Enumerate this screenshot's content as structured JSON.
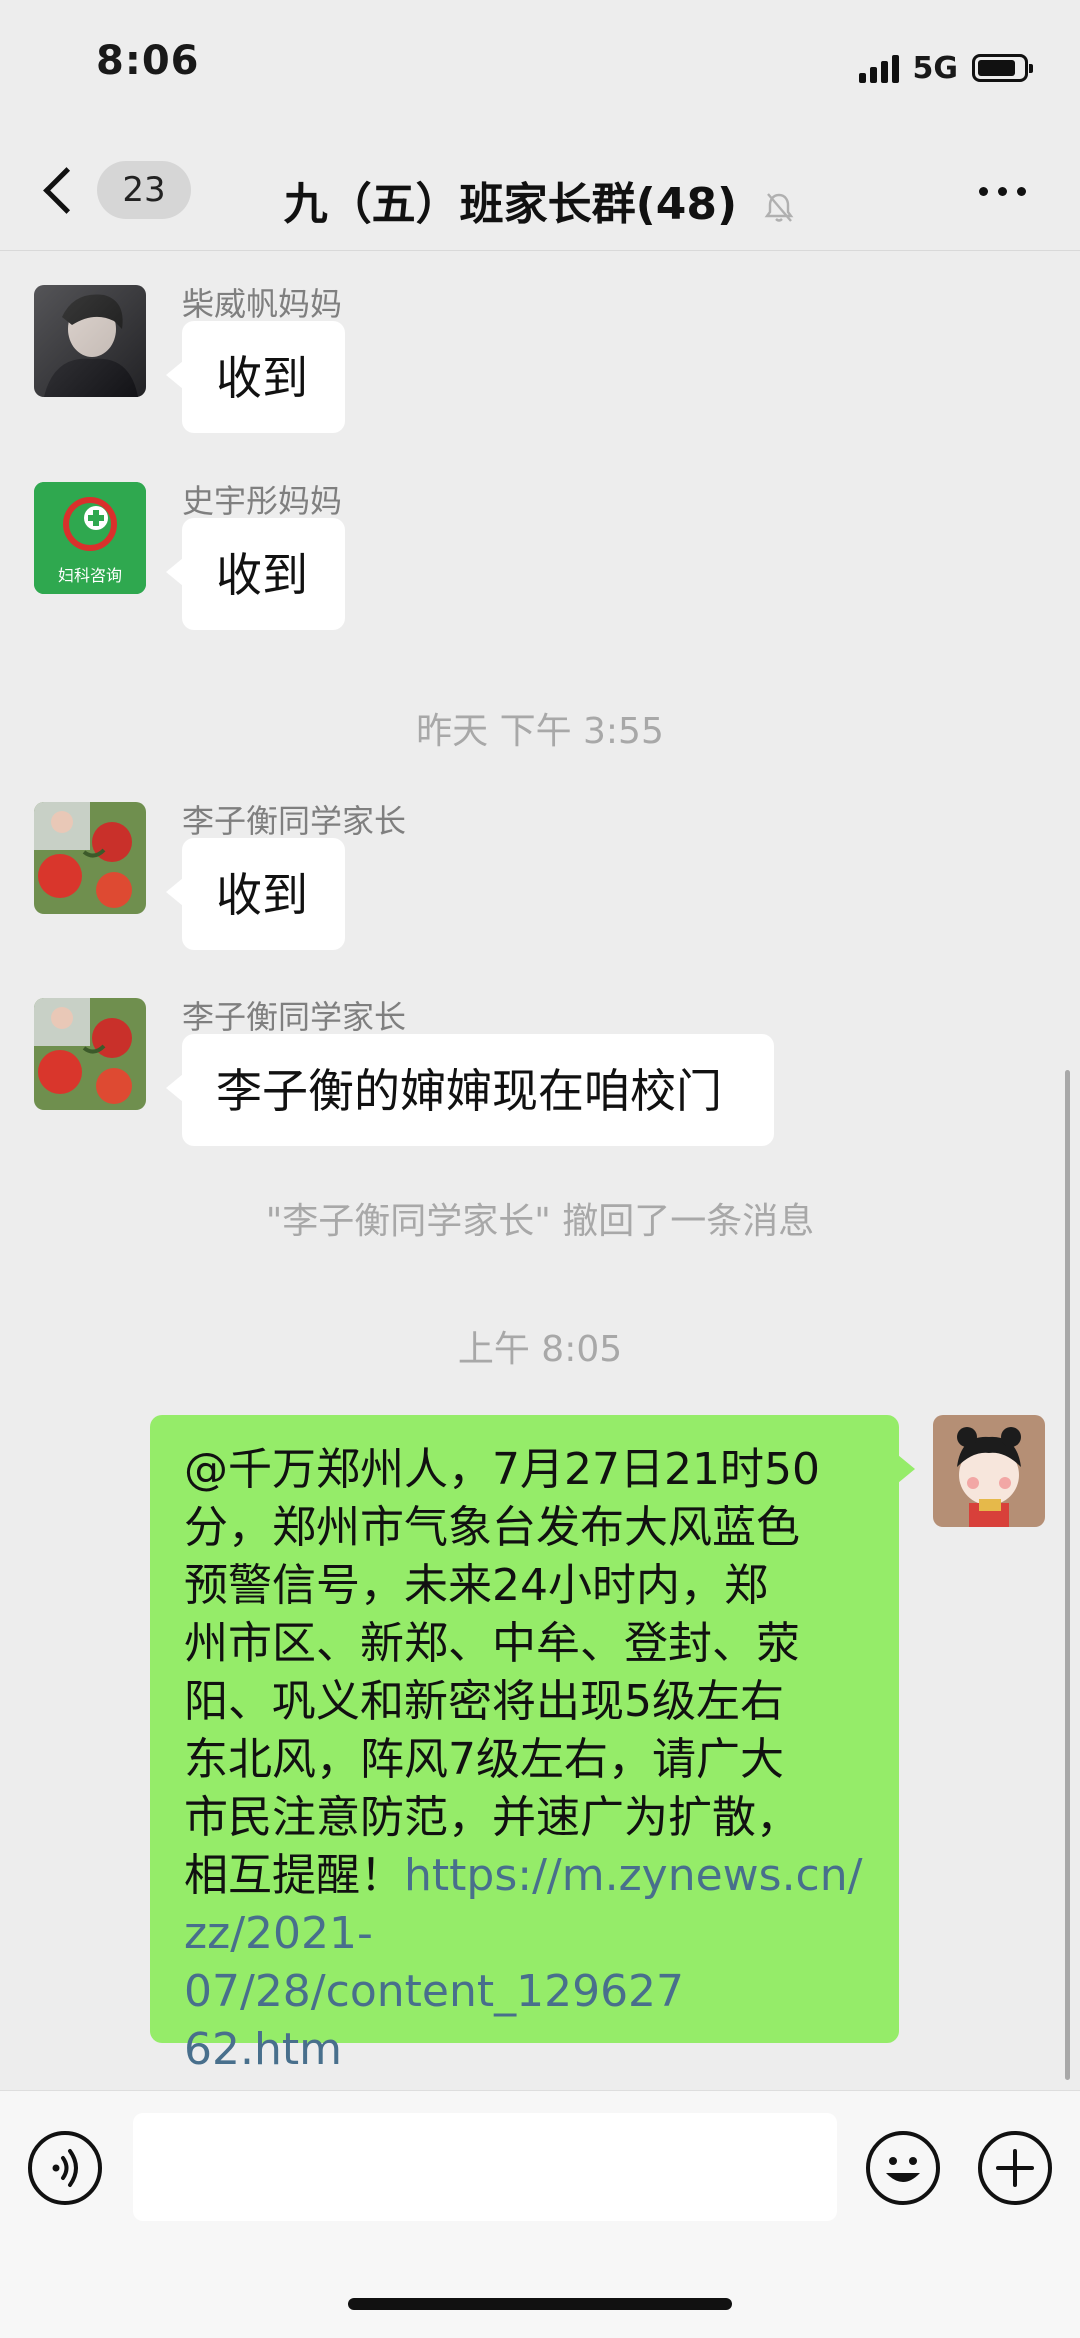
{
  "status_bar": {
    "time": "8:06",
    "network": "5G",
    "battery_level": 0.85
  },
  "nav": {
    "unread_count": "23",
    "title": "九（五）班家长群(48)",
    "muted": true
  },
  "messages": [
    {
      "type": "incoming",
      "sender": "柴威帆妈妈",
      "avatar": "dark-portrait",
      "text": "收到"
    },
    {
      "type": "incoming",
      "sender": "史宇彤妈妈",
      "avatar": "green-app-logo",
      "avatar_text": "妇科咨询",
      "text": "收到"
    },
    {
      "type": "time",
      "text": "昨天 下午 3:55"
    },
    {
      "type": "incoming",
      "sender": "李子衡同学家长",
      "avatar": "tomato-photo",
      "text": "收到"
    },
    {
      "type": "incoming",
      "sender": "李子衡同学家长",
      "avatar": "tomato-photo",
      "text": "李子衡的婶婶现在咱校门"
    },
    {
      "type": "system",
      "text": "\"李子衡同学家长\" 撤回了一条消息"
    },
    {
      "type": "time",
      "text": "上午 8:05"
    },
    {
      "type": "outgoing",
      "avatar": "cartoon-girl",
      "lines": [
        "@千万郑州人，7月27日21时50",
        "分，郑州市气象台发布大风蓝色",
        "预警信号，未来24小时内，郑",
        "州市区、新郑、中牟、登封、荥",
        "阳、巩义和新密将出现5级左右",
        "东北风，阵风7级左右，请广大",
        "市民注意防范，并速广为扩散，"
      ],
      "line_8_prefix": "相互提醒！",
      "link_parts": [
        "https://m.zynews.cn/",
        "zz/2021-07/28/content_129627",
        "62.htm"
      ]
    }
  ],
  "colors": {
    "background": "#ededed",
    "outgoing_bubble": "#95ec69",
    "incoming_bubble": "#ffffff",
    "link": "#486f8c",
    "meta_text": "#a8a8a8"
  }
}
